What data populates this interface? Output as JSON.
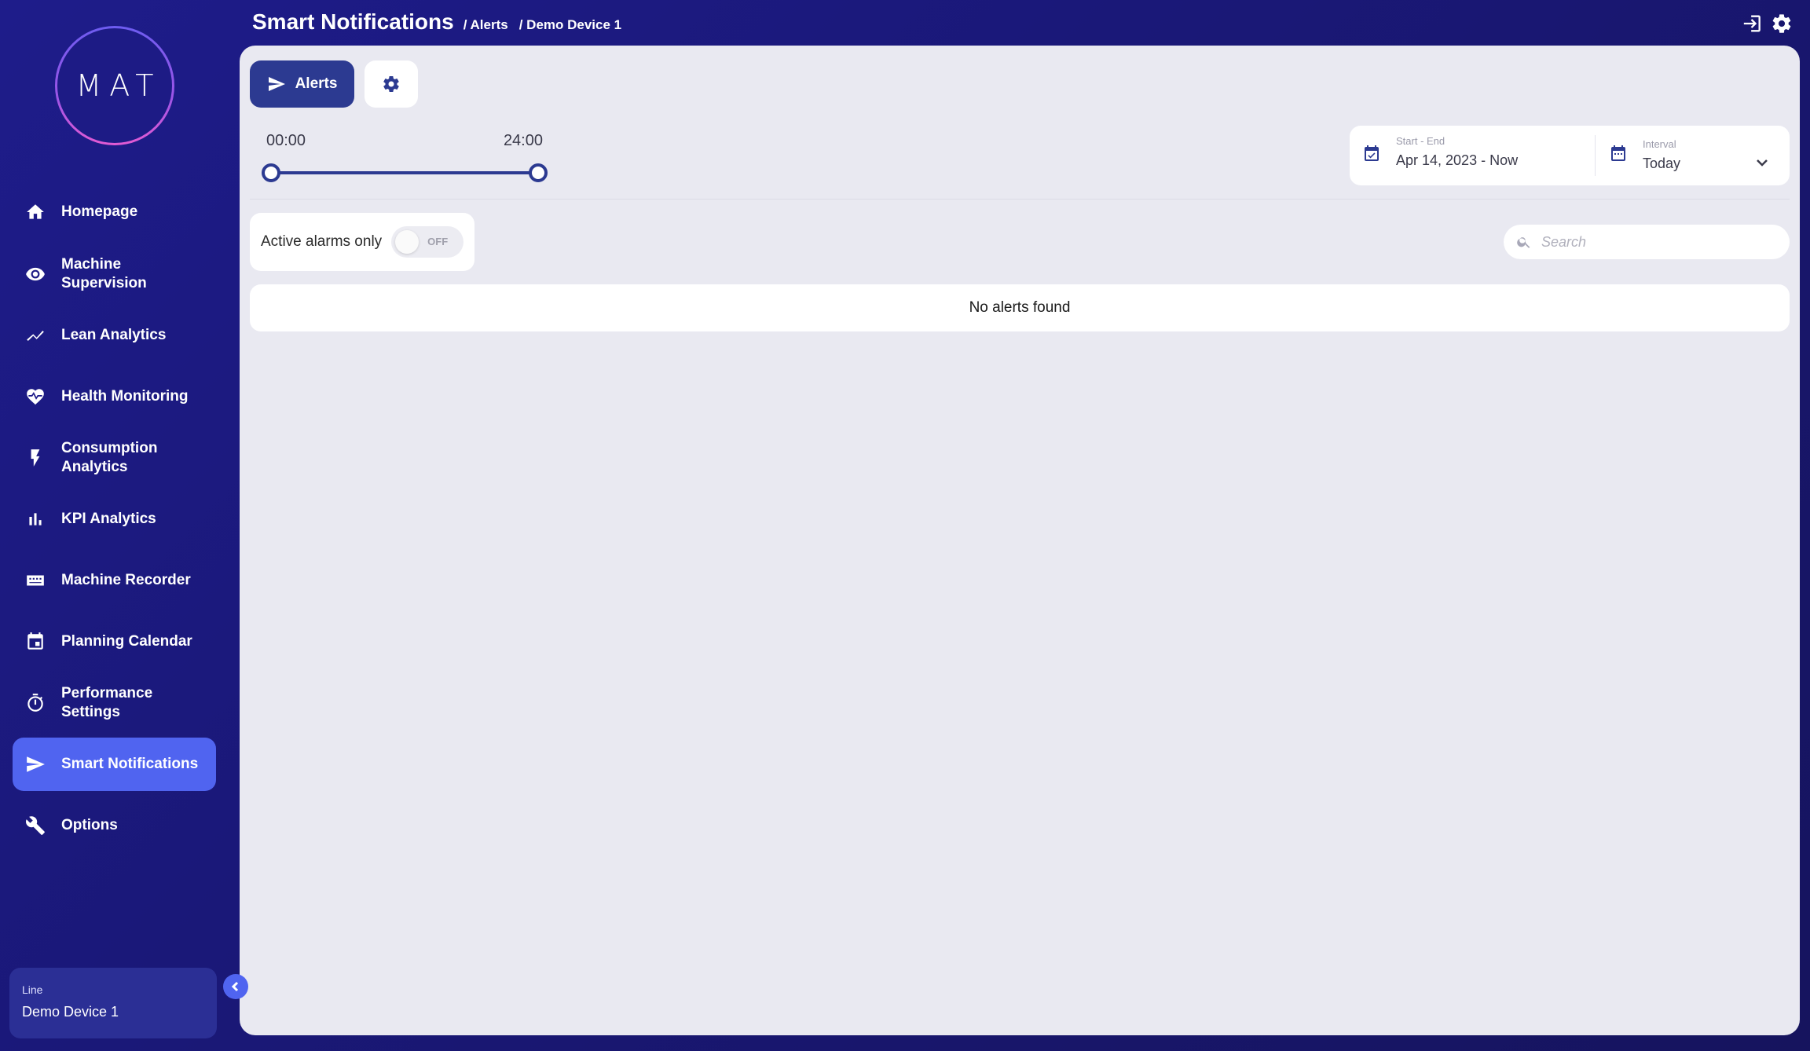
{
  "logo": {
    "text": "MAT"
  },
  "sidebar": {
    "items": [
      {
        "label": "Homepage",
        "icon": "home-icon",
        "active": false
      },
      {
        "label": "Machine Supervision",
        "icon": "eye-icon",
        "active": false
      },
      {
        "label": "Lean Analytics",
        "icon": "trend-line-icon",
        "active": false
      },
      {
        "label": "Health Monitoring",
        "icon": "heart-pulse-icon",
        "active": false
      },
      {
        "label": "Consumption Analytics",
        "icon": "bolt-icon",
        "active": false
      },
      {
        "label": "KPI Analytics",
        "icon": "bar-chart-icon",
        "active": false
      },
      {
        "label": "Machine Recorder",
        "icon": "recorder-icon",
        "active": false
      },
      {
        "label": "Planning Calendar",
        "icon": "calendar-icon",
        "active": false
      },
      {
        "label": "Performance Settings",
        "icon": "timer-icon",
        "active": false
      },
      {
        "label": "Smart Notifications",
        "icon": "send-icon",
        "active": true
      },
      {
        "label": "Options",
        "icon": "wrench-icon",
        "active": false
      }
    ],
    "line": {
      "label": "Line",
      "value": "Demo Device 1"
    }
  },
  "header": {
    "title": "Smart Notifications",
    "breadcrumbs": [
      "/ Alerts",
      "/ Demo Device 1"
    ]
  },
  "tabs": {
    "alerts_label": "Alerts"
  },
  "time_slider": {
    "start": "00:00",
    "end": "24:00",
    "range_fraction": [
      0,
      1
    ]
  },
  "date_range": {
    "label": "Start - End",
    "value": "Apr 14, 2023 - Now",
    "interval_label": "Interval",
    "interval_value": "Today"
  },
  "filter": {
    "active_alarms_label": "Active alarms only",
    "toggle_state": "OFF"
  },
  "search": {
    "placeholder": "Search"
  },
  "results": {
    "empty_message": "No alerts found"
  },
  "colors": {
    "sidebar_bg": "#1e1c8a",
    "active_item": "#5064f0",
    "primary": "#2c3a91",
    "panel_bg": "#e9e9f1"
  }
}
